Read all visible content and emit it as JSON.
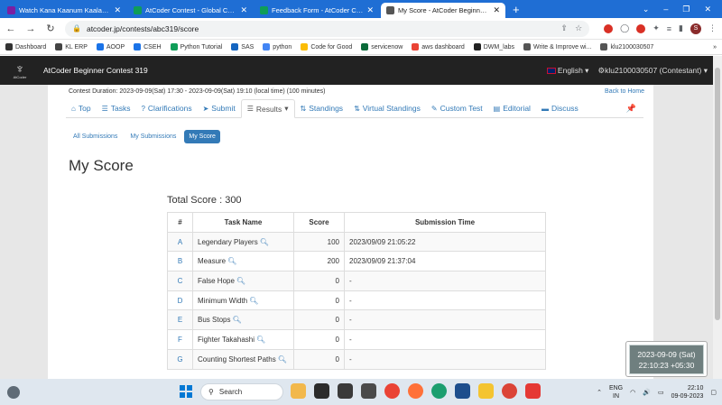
{
  "browser": {
    "tabs": [
      {
        "title": "Watch Kana Kaanum Kaalangal S...",
        "favicon_color": "#7b1fa2",
        "active": false
      },
      {
        "title": "AtCoder Contest - Global Challe...",
        "favicon_color": "#0f9d58",
        "active": false
      },
      {
        "title": "Feedback Form - AtCoder Conte...",
        "favicon_color": "#0f9d58",
        "active": false
      },
      {
        "title": "My Score - AtCoder Beginner Co...",
        "favicon_color": "#555555",
        "active": true
      }
    ],
    "new_tab": "+",
    "url": "atcoder.jp/contests/abc319/score",
    "bookmarks": [
      {
        "label": "Dashboard",
        "color": "#333333"
      },
      {
        "label": "KL ERP",
        "color": "#444444"
      },
      {
        "label": "AOOP",
        "color": "#1a73e8"
      },
      {
        "label": "CSEH",
        "color": "#1a73e8"
      },
      {
        "label": "Python Tutorial",
        "color": "#0f9d58"
      },
      {
        "label": "SAS",
        "color": "#1565c0"
      },
      {
        "label": "python",
        "color": "#4285f4"
      },
      {
        "label": "Code for Good",
        "color": "#fbbc05"
      },
      {
        "label": "servicenow",
        "color": "#0b6b3a"
      },
      {
        "label": "aws dashboard",
        "color": "#ea4335"
      },
      {
        "label": "DWM_labs",
        "color": "#222222"
      },
      {
        "label": "Write & Improve wi...",
        "color": "#555555"
      },
      {
        "label": "klu2100030507",
        "color": "#555555"
      }
    ],
    "more_bookmarks": "»"
  },
  "site": {
    "logo_text": "AtCoder",
    "contest_title": "AtCoder Beginner Contest 319",
    "language": "English",
    "user": "klu2100030507 (Contestant)"
  },
  "contest": {
    "duration": "Contest Duration: 2023-09-09(Sat) 17:30 - 2023-09-09(Sat) 19:10 (local time) (100 minutes)",
    "back_home": "Back to Home",
    "tabs": [
      {
        "label": "Top",
        "icon": "home-icon",
        "glyph": "⌂"
      },
      {
        "label": "Tasks",
        "icon": "list-icon",
        "glyph": "☰"
      },
      {
        "label": "Clarifications",
        "icon": "question-icon",
        "glyph": "?"
      },
      {
        "label": "Submit",
        "icon": "send-icon",
        "glyph": "➤"
      },
      {
        "label": "Results",
        "icon": "list-alt-icon",
        "glyph": "☰",
        "active": true,
        "caret": "▾"
      },
      {
        "label": "Standings",
        "icon": "sort-icon",
        "glyph": "⇅"
      },
      {
        "label": "Virtual Standings",
        "icon": "sort-icon",
        "glyph": "⇅"
      },
      {
        "label": "Custom Test",
        "icon": "wrench-icon",
        "glyph": "✎"
      },
      {
        "label": "Editorial",
        "icon": "book-icon",
        "glyph": "▤"
      },
      {
        "label": "Discuss",
        "icon": "comment-icon",
        "glyph": "▬"
      }
    ],
    "pin_glyph": "📌",
    "subtabs": [
      {
        "label": "All Submissions",
        "active": false
      },
      {
        "label": "My Submissions",
        "active": false
      },
      {
        "label": "My Score",
        "active": true
      }
    ],
    "page_title": "My Score",
    "total_score": "Total Score : 300",
    "table": {
      "headers": [
        "#",
        "Task Name",
        "Score",
        "Submission Time"
      ],
      "rows": [
        {
          "idx": "A",
          "task": "Legendary Players",
          "score": "100",
          "time": "2023/09/09 21:05:22"
        },
        {
          "idx": "B",
          "task": "Measure",
          "score": "200",
          "time": "2023/09/09 21:37:04"
        },
        {
          "idx": "C",
          "task": "False Hope",
          "score": "0",
          "time": "-"
        },
        {
          "idx": "D",
          "task": "Minimum Width",
          "score": "0",
          "time": "-"
        },
        {
          "idx": "E",
          "task": "Bus Stops",
          "score": "0",
          "time": "-"
        },
        {
          "idx": "F",
          "task": "Fighter Takahashi",
          "score": "0",
          "time": "-"
        },
        {
          "idx": "G",
          "task": "Counting Shortest Paths",
          "score": "0",
          "time": "-"
        }
      ]
    }
  },
  "overlay_clock": {
    "date": "2023-09-09 (Sat)",
    "time": "22:10:23 +05:30"
  },
  "taskbar": {
    "search_placeholder": "Search",
    "lang_line1": "ENG",
    "lang_line2": "IN",
    "clock_time": "22:10",
    "clock_date": "09-09-2023"
  }
}
